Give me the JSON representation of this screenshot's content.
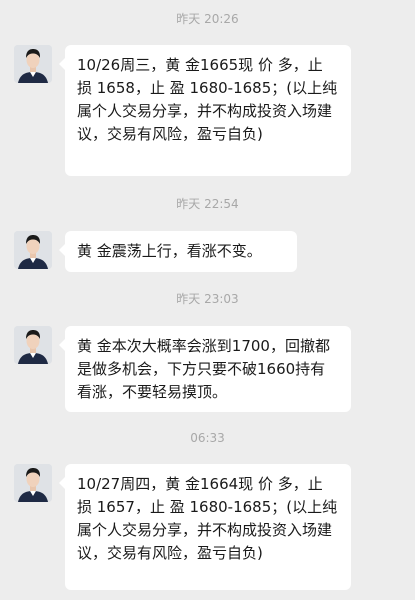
{
  "messages": [
    {
      "time": "昨天 20:26",
      "text": "10/26周三，黄 金1665现 价 多，止 损 1658，止 盈 1680-1685；(以上纯属个人交易分享，并不构成投资入场建议，交易有风险，盈亏自负)"
    },
    {
      "time": "昨天 22:54",
      "text": "黄 金震荡上行，看涨不变。"
    },
    {
      "time": "昨天 23:03",
      "text": "黄 金本次大概率会涨到1700，回撤都是做多机会，下方只要不破1660持有看涨，不要轻易摸顶。"
    },
    {
      "time": "06:33",
      "text": "10/27周四，黄 金1664现 价 多，止 损 1657，止 盈 1680-1685；(以上纯属个人交易分享，并不构成投资入场建议，交易有风险，盈亏自负)"
    }
  ]
}
